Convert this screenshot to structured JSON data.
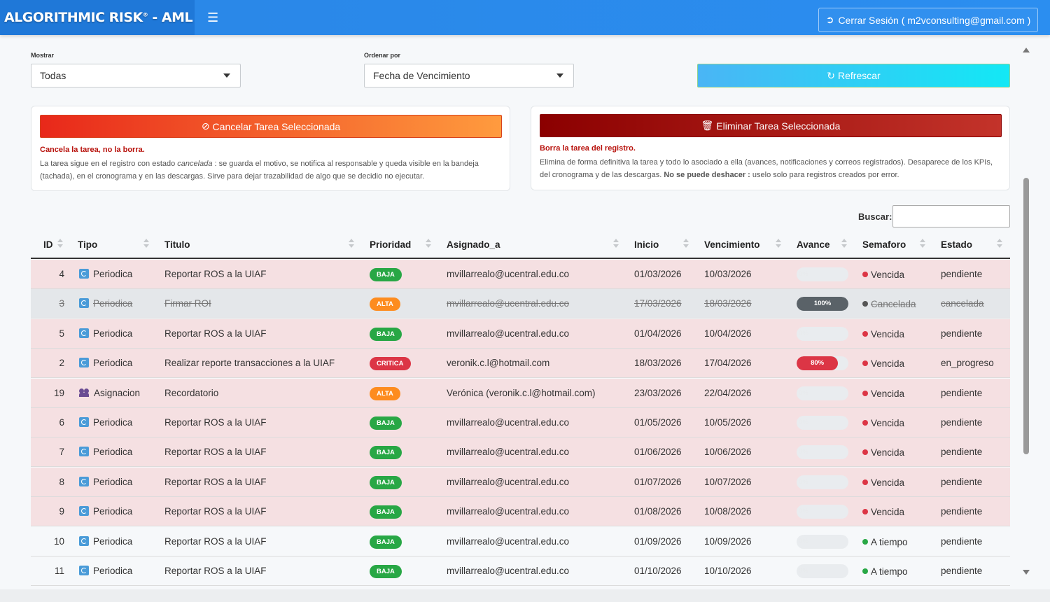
{
  "header": {
    "brand": "ALGORITHMIC RISK",
    "brand_reg": "®",
    "brand_suffix": " - AML",
    "menu_icon": "hamburger-icon",
    "logout_label": "Cerrar Sesión ( m2vconsulting@gmail.com )"
  },
  "filters": {
    "show_label": "Mostrar",
    "show_value": "Todas",
    "order_label": "Ordenar por",
    "order_value": "Fecha de Vencimiento",
    "refresh_label": "Refrescar"
  },
  "cancel_card": {
    "button_label": "Cancelar Tarea Seleccionada",
    "title": "Cancela la tarea, no la borra.",
    "desc_1": "La tarea sigue en el registro con estado ",
    "desc_em": "cancelada",
    "desc_2": " : se guarda el motivo, se notifica al responsable y queda visible en la bandeja",
    "desc_3": "(tachada), en el cronograma y en las descargas. Sirve para dejar trazabilidad de algo que se decidio no ejecutar."
  },
  "delete_card": {
    "button_label": "Eliminar Tarea Seleccionada",
    "title": "Borra la tarea del registro.",
    "desc_1": "Elimina de forma definitiva la tarea y todo lo asociado a ella (avances, notificaciones y correos registrados). Desaparece de los KPIs,",
    "desc_2": "del cronograma y de las descargas. ",
    "desc_strong": "No se puede deshacer :",
    "desc_3": " uselo solo para registros creados por error."
  },
  "search": {
    "label": "Buscar:",
    "value": ""
  },
  "table": {
    "columns": [
      "ID",
      "Tipo",
      "Titulo",
      "Prioridad",
      "Asignado_a",
      "Inicio",
      "Vencimiento",
      "Avance",
      "Semaforo",
      "Estado"
    ],
    "rows": [
      {
        "id": "4",
        "tipo": "Periodica",
        "titulo": "Reportar ROS a la UIAF",
        "prioridad": "BAJA",
        "asignado": "mvillarrealo@ucentral.edu.co",
        "inicio": "01/03/2026",
        "vencimiento": "10/03/2026",
        "avance": "0%",
        "semaforo": "Vencida",
        "estado": "pendiente"
      },
      {
        "id": "3",
        "tipo": "Periodica",
        "titulo": "Firmar ROI",
        "prioridad": "ALTA",
        "asignado": "mvillarrealo@ucentral.edu.co",
        "inicio": "17/03/2026",
        "vencimiento": "18/03/2026",
        "avance": "100%",
        "semaforo": "Cancelada",
        "estado": "cancelada"
      },
      {
        "id": "5",
        "tipo": "Periodica",
        "titulo": "Reportar ROS a la UIAF",
        "prioridad": "BAJA",
        "asignado": "mvillarrealo@ucentral.edu.co",
        "inicio": "01/04/2026",
        "vencimiento": "10/04/2026",
        "avance": "0%",
        "semaforo": "Vencida",
        "estado": "pendiente"
      },
      {
        "id": "2",
        "tipo": "Periodica",
        "titulo": "Realizar reporte transacciones a la UIAF",
        "prioridad": "CRITICA",
        "asignado": "veronik.c.l@hotmail.com",
        "inicio": "18/03/2026",
        "vencimiento": "17/04/2026",
        "avance": "80%",
        "semaforo": "Vencida",
        "estado": "en_progreso"
      },
      {
        "id": "19",
        "tipo": "Asignacion",
        "titulo": "Recordatorio",
        "prioridad": "ALTA",
        "asignado": "Verónica (veronik.c.l@hotmail.com)",
        "inicio": "23/03/2026",
        "vencimiento": "22/04/2026",
        "avance": "0%",
        "semaforo": "Vencida",
        "estado": "pendiente"
      },
      {
        "id": "6",
        "tipo": "Periodica",
        "titulo": "Reportar ROS a la UIAF",
        "prioridad": "BAJA",
        "asignado": "mvillarrealo@ucentral.edu.co",
        "inicio": "01/05/2026",
        "vencimiento": "10/05/2026",
        "avance": "0%",
        "semaforo": "Vencida",
        "estado": "pendiente"
      },
      {
        "id": "7",
        "tipo": "Periodica",
        "titulo": "Reportar ROS a la UIAF",
        "prioridad": "BAJA",
        "asignado": "mvillarrealo@ucentral.edu.co",
        "inicio": "01/06/2026",
        "vencimiento": "10/06/2026",
        "avance": "0%",
        "semaforo": "Vencida",
        "estado": "pendiente"
      },
      {
        "id": "8",
        "tipo": "Periodica",
        "titulo": "Reportar ROS a la UIAF",
        "prioridad": "BAJA",
        "asignado": "mvillarrealo@ucentral.edu.co",
        "inicio": "01/07/2026",
        "vencimiento": "10/07/2026",
        "avance": "0%",
        "semaforo": "Vencida",
        "estado": "pendiente"
      },
      {
        "id": "9",
        "tipo": "Periodica",
        "titulo": "Reportar ROS a la UIAF",
        "prioridad": "BAJA",
        "asignado": "mvillarrealo@ucentral.edu.co",
        "inicio": "01/08/2026",
        "vencimiento": "10/08/2026",
        "avance": "0%",
        "semaforo": "Vencida",
        "estado": "pendiente"
      },
      {
        "id": "10",
        "tipo": "Periodica",
        "titulo": "Reportar ROS a la UIAF",
        "prioridad": "BAJA",
        "asignado": "mvillarrealo@ucentral.edu.co",
        "inicio": "01/09/2026",
        "vencimiento": "10/09/2026",
        "avance": "0%",
        "semaforo": "A tiempo",
        "estado": "pendiente"
      },
      {
        "id": "11",
        "tipo": "Periodica",
        "titulo": "Reportar ROS a la UIAF",
        "prioridad": "BAJA",
        "asignado": "mvillarrealo@ucentral.edu.co",
        "inicio": "01/10/2026",
        "vencimiento": "10/10/2026",
        "avance": "0%",
        "semaforo": "A tiempo",
        "estado": "pendiente"
      }
    ]
  },
  "colors": {
    "header": "#2a86e6",
    "baja": "#28a745",
    "alta": "#fd8c1f",
    "critica": "#dc3545",
    "vencida_dot": "#dc3545",
    "atiempo_dot": "#28a745",
    "cancelada_dot": "#555555",
    "progress_full": "#5a6268",
    "progress_critica": "#dc3545"
  }
}
